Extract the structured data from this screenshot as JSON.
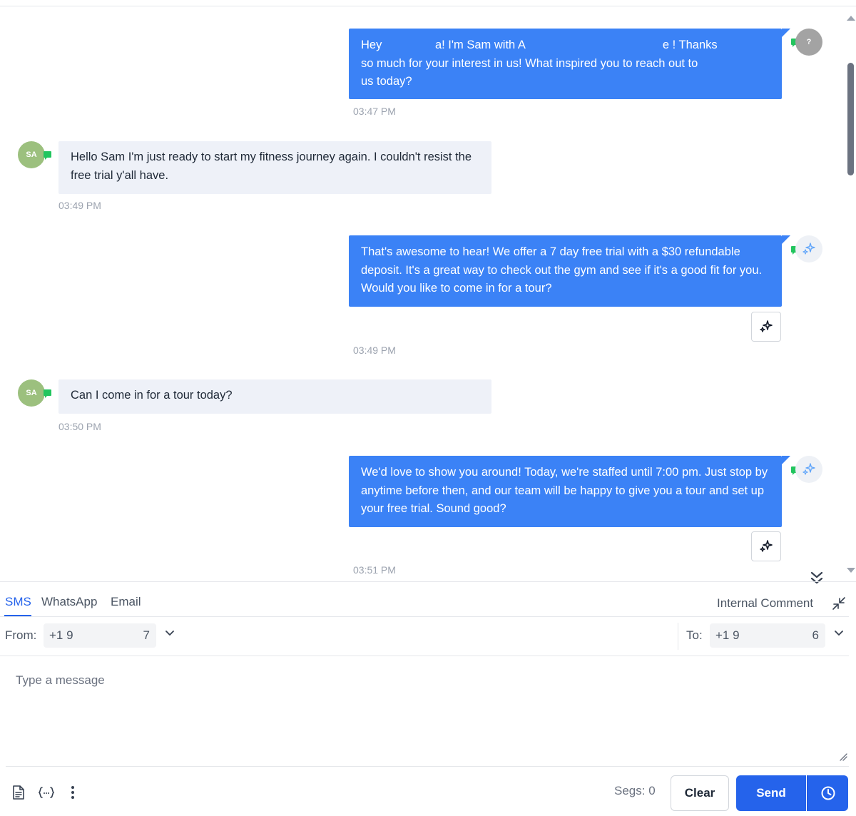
{
  "messages": [
    {
      "direction": "outbound",
      "text_parts": [
        "Hey ",
        "a!  I'm Sam with A",
        "e !  Thanks",
        "so much for your interest in us!  What inspired you to reach out to",
        "us today?"
      ],
      "time": "03:47 PM",
      "avatar": "?"
    },
    {
      "direction": "inbound",
      "text": "Hello Sam I'm just ready to start my fitness journey again. I couldn't resist the free trial y'all have.",
      "time": "03:49 PM",
      "avatar": "SA"
    },
    {
      "direction": "outbound",
      "text": "That's awesome to hear! We offer a 7 day free trial with a $30 refundable deposit. It's a great way to check out the gym and see if it's a good fit for you. Would you like to come in for a tour?",
      "time": "03:49 PM",
      "avatar_icon": "ai-sparkle-icon"
    },
    {
      "direction": "inbound",
      "text": "Can I come in for a tour today?",
      "time": "03:50 PM",
      "avatar": "SA"
    },
    {
      "direction": "outbound",
      "text": "We'd love to show you around! Today, we're staffed until 7:00 pm. Just stop by anytime before then, and our team will be happy to give you a tour and set up your free trial. Sound good?",
      "time": "03:51 PM",
      "avatar_icon": "ai-sparkle-icon"
    }
  ],
  "composer": {
    "tabs": [
      "SMS",
      "WhatsApp",
      "Email"
    ],
    "active_tab": "SMS",
    "internal_comment": "Internal Comment",
    "from_label": "From:",
    "from_value_start": "+1 9",
    "from_value_end": "7",
    "to_label": "To:",
    "to_value_start": "+1 9",
    "to_value_end": "6",
    "placeholder": "Type a message",
    "segs_label": "Segs: 0",
    "clear_label": "Clear",
    "send_label": "Send"
  },
  "colors": {
    "accent": "#2563eb",
    "outbound_bubble": "#3b82f6",
    "inbound_bubble": "#eef1f8",
    "contact_avatar": "#9cc07e",
    "channel_flag": "#22c55e"
  }
}
